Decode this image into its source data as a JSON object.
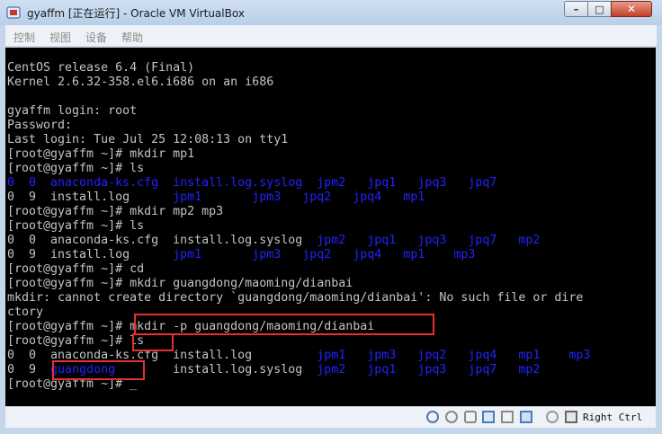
{
  "window": {
    "title": "gyaffm [正在运行] - Oracle VM VirtualBox"
  },
  "menu": {
    "items": [
      "控制",
      "视图",
      "设备",
      "帮助"
    ]
  },
  "terminal": {
    "line1": "CentOS release 6.4 (Final)",
    "line2": "Kernel 2.6.32-358.el6.i686 on an i686",
    "line3": "gyaffm login: root",
    "line4": "Password:",
    "line5": "Last login: Tue Jul 25 12:08:13 on tty1",
    "line6": "[root@gyaffm ~]# mkdir mp1",
    "line7": "[root@gyaffm ~]# ls",
    "l8a": "0  0  anaconda-ks.cfg  install.log.syslog  ",
    "l8b": "jpm2   jpq1   jpq3   jpq7",
    "l9a": "0  9  install.log      ",
    "l9b": "jpm1",
    "l9c": "       jpm3   jpq2   jpq4   mp1",
    "line10": "[root@gyaffm ~]# mkdir mp2 mp3",
    "line11": "[root@gyaffm ~]# ls",
    "l12a": "0  0  anaconda-ks.cfg  install.log.syslog  ",
    "l12b": "jpm2   jpq1   jpq3   jpq7   mp2",
    "l13a": "0  9  install.log      ",
    "l13b": "jpm1",
    "l13c": "       jpm3   jpq2   jpq4   mp1    mp3",
    "line14": "[root@gyaffm ~]# cd",
    "line15": "[root@gyaffm ~]# mkdir guangdong/maoming/dianbai",
    "line16": "mkdir: cannot create directory `guangdong/maoming/dianbai': No such file or dire",
    "line17": "ctory",
    "line18": "[root@gyaffm ~]# mkdir -p guangdong/maoming/dianbai",
    "line19": "[root@gyaffm ~]# ls",
    "l20a": "0  0  anaconda-ks.cfg  install.log         ",
    "l20b": "jpm1   jpm3   jpq2   jpq4   mp1    mp3",
    "l21a": "0  9  ",
    "l21b": "guangdong",
    "l21c": "        install.log.syslog  ",
    "l21d": "jpm2   jpq1   jpq3   jpq7   mp2",
    "line22": "[root@gyaffm ~]# "
  },
  "status": {
    "host_key": "Right Ctrl"
  },
  "colors": {
    "highlight": "#e53030",
    "dir_blue": "#2222ff",
    "text_grey": "#c4c4c4"
  }
}
